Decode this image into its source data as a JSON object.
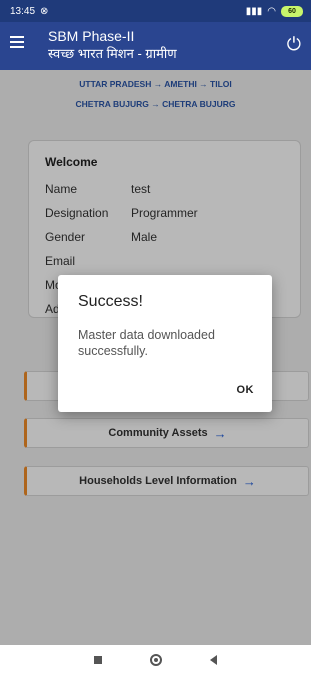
{
  "status_bar": {
    "time": "13:45",
    "battery": "60",
    "icons": [
      "alarm-icon",
      "signal-icon",
      "wifi-icon",
      "battery-icon"
    ]
  },
  "app_bar": {
    "title": "SBM Phase-II",
    "subtitle": "स्वच्छ भारत मिशन - ग्रामीण",
    "menu_icon": "hamburger-icon",
    "power_icon": "power-icon"
  },
  "breadcrumb": {
    "line1": "UTTAR PRADESH → AMETHI → TILOI",
    "line2": "CHETRA BUJURG → CHETRA BUJURG"
  },
  "profile": {
    "welcome": "Welcome",
    "rows": [
      {
        "key": "Name",
        "value": "test"
      },
      {
        "key": "Designation",
        "value": "Programmer"
      },
      {
        "key": "Gender",
        "value": "Male"
      },
      {
        "key": "Email",
        "value": ""
      },
      {
        "key": "Mo",
        "value": ""
      },
      {
        "key": "Ad",
        "value": ""
      }
    ]
  },
  "sections": [
    {
      "label": "",
      "arrow": ""
    },
    {
      "label": "Community Assets",
      "arrow": "→"
    },
    {
      "label": "Households Level Information",
      "arrow": "→"
    }
  ],
  "dialog": {
    "title": "Success!",
    "message": "Master data downloaded successfully.",
    "ok": "OK"
  },
  "colors": {
    "app_bar": "#2a4590",
    "status_bar": "#1f3a7a",
    "accent_orange": "#f28c28",
    "arrow_blue": "#1e5bd8",
    "breadcrumb_blue": "#2a55a8"
  }
}
